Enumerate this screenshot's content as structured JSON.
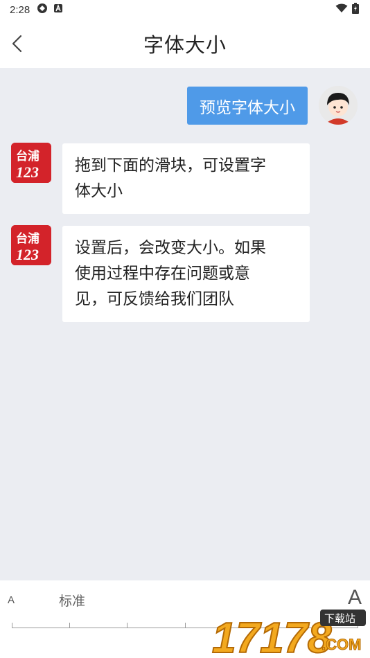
{
  "status_bar": {
    "time": "2:28"
  },
  "nav": {
    "title": "字体大小"
  },
  "chat": {
    "user_message": "预览字体大小",
    "bot_messages": [
      {
        "line1": "拖到下面的滑块，可设置字",
        "line2": "体大小",
        "line3": ""
      },
      {
        "line1": "设置后，会改变大小。如果",
        "line2": "使用过程中存在问题或意",
        "line3": "见，可反馈给我们团队"
      }
    ],
    "bot_logo": {
      "top": "台浦",
      "bottom": "123"
    }
  },
  "font_panel": {
    "small_label": "A",
    "level_label": "标准",
    "large_label": "A",
    "slider_level_index": 1,
    "slider_levels_total": 7
  },
  "watermark": {
    "number": "17178",
    "tag": "下载站",
    "suffix": ".COM"
  },
  "colors": {
    "accent": "#4f9ae8",
    "chat_bg": "#ebedf2",
    "logo_red": "#d3232a"
  }
}
